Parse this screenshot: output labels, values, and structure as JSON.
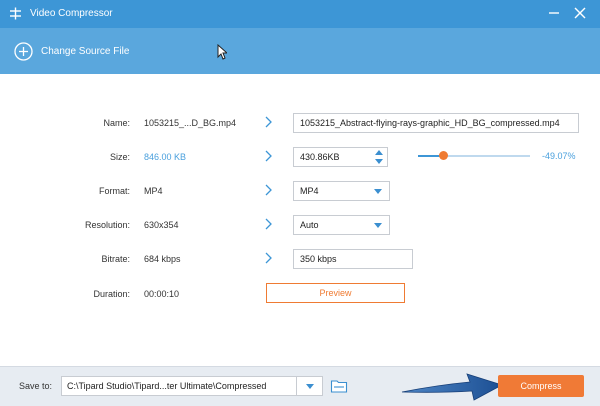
{
  "window": {
    "title": "Video Compressor",
    "minimize_icon": "minimize-icon",
    "close_icon": "close-icon"
  },
  "source": {
    "change_label": "Change Source File",
    "icon": "plus-circle-icon"
  },
  "rows": {
    "name": {
      "label": "Name:",
      "original": "1053215_...D_BG.mp4",
      "output": "1053215_Abstract-flying-rays-graphic_HD_BG_compressed.mp4"
    },
    "size": {
      "label": "Size:",
      "original": "846.00 KB",
      "output": "430.86KB",
      "percent": "-49.07%",
      "slider_fraction": 0.22
    },
    "format": {
      "label": "Format:",
      "original": "MP4",
      "selected": "MP4"
    },
    "resolution": {
      "label": "Resolution:",
      "original": "630x354",
      "selected": "Auto"
    },
    "bitrate": {
      "label": "Bitrate:",
      "original": "684 kbps",
      "output": "350 kbps"
    },
    "duration": {
      "label": "Duration:",
      "original": "00:00:10"
    }
  },
  "preview_label": "Preview",
  "save": {
    "label": "Save to:",
    "path": "C:\\Tipard Studio\\Tipard...ter Ultimate\\Compressed"
  },
  "compress_label": "Compress",
  "colors": {
    "titlebar": "#3d96d6",
    "sourcebar": "#5aa7dd",
    "accent_orange": "#f07a36",
    "accent_blue": "#4aa0dd"
  }
}
